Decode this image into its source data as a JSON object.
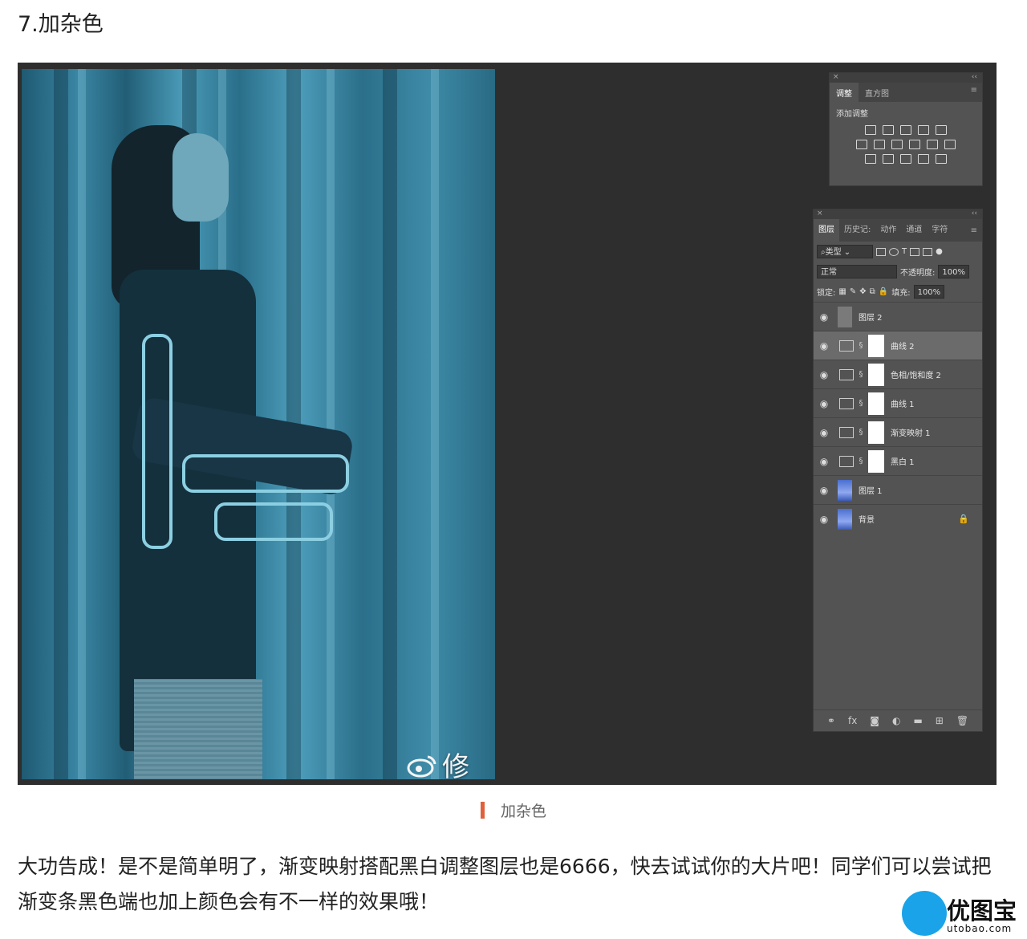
{
  "heading": "7.加杂色",
  "watermark": "修图师-欧仕逍",
  "adjust_panel": {
    "tabs": [
      "调整",
      "直方图"
    ],
    "active_tab": "调整",
    "subtitle": "添加调整",
    "icon_rows": [
      [
        "brightness-contrast-icon",
        "levels-icon",
        "curves-icon",
        "exposure-icon",
        "vibrance-icon"
      ],
      [
        "hue-saturation-icon",
        "color-balance-icon",
        "black-white-icon",
        "photo-filter-icon",
        "channel-mixer-icon",
        "color-lookup-icon"
      ],
      [
        "invert-icon",
        "posterize-icon",
        "threshold-icon",
        "selective-color-icon",
        "gradient-map-icon"
      ]
    ]
  },
  "layers_panel": {
    "tabs": [
      "图层",
      "历史记:",
      "动作",
      "通道",
      "字符"
    ],
    "active_tab": "图层",
    "filter_kind": "类型",
    "blend_mode": "正常",
    "opacity_label": "不透明度:",
    "opacity_value": "100%",
    "lock_label": "锁定:",
    "fill_label": "填充:",
    "fill_value": "100%",
    "layers": [
      {
        "name": "图层 2",
        "kind": "gray"
      },
      {
        "name": "曲线 2",
        "kind": "adjustment",
        "selected": true
      },
      {
        "name": "色相/饱和度 2",
        "kind": "adjustment"
      },
      {
        "name": "曲线 1",
        "kind": "adjustment"
      },
      {
        "name": "渐变映射 1",
        "kind": "adjustment"
      },
      {
        "name": "黑白 1",
        "kind": "adjustment"
      },
      {
        "name": "图层 1",
        "kind": "image"
      },
      {
        "name": "背景",
        "kind": "image",
        "locked": true
      }
    ]
  },
  "caption": "加杂色",
  "body_text": "大功告成！是不是简单明了，渐变映射搭配黑白调整图层也是6666，快去试试你的大片吧！同学们可以尝试把渐变条黑色端也加上颜色会有不一样的效果哦！",
  "logo": {
    "name": "优图宝",
    "url": "utobao.com"
  }
}
